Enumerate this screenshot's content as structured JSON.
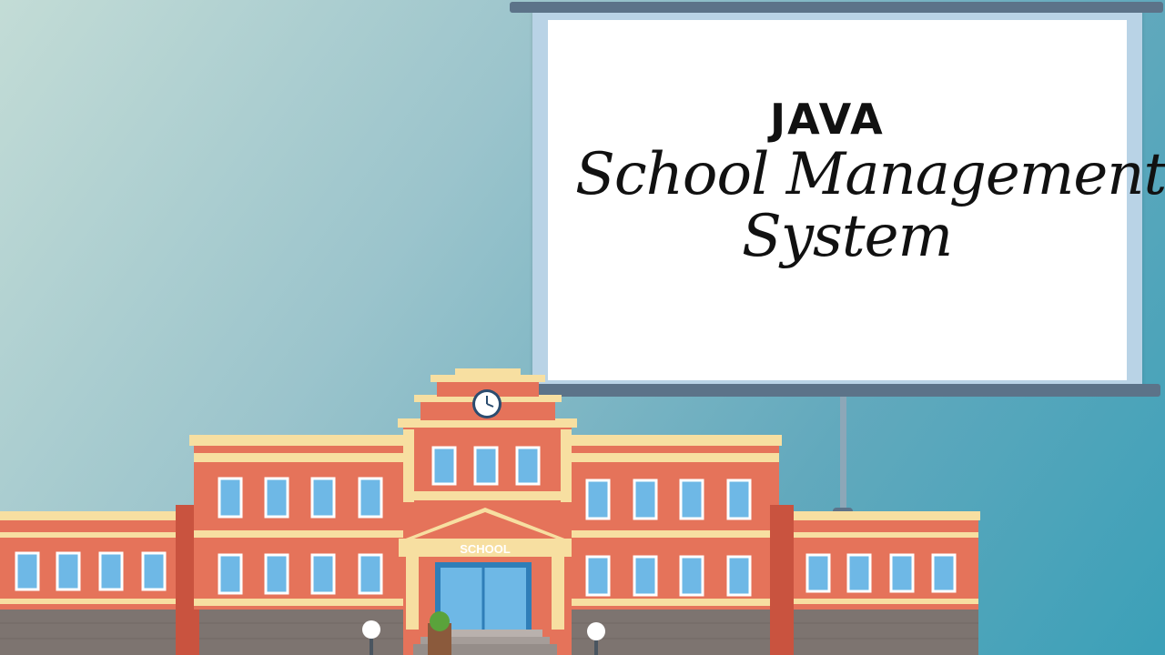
{
  "board": {
    "title_top": "JAVA",
    "title_line1": "School Management",
    "title_line2": "System"
  },
  "building": {
    "sign": "SCHOOL"
  },
  "colors": {
    "background_light": "#c3dcd6",
    "background_dark": "#3ba0b8",
    "brick": "#e5735a",
    "trim": "#f7dfa1",
    "window": "#6eb8e6",
    "rail": "#5c7389"
  },
  "icons": [
    "clock-icon",
    "lamp-icon",
    "bush-icon"
  ]
}
